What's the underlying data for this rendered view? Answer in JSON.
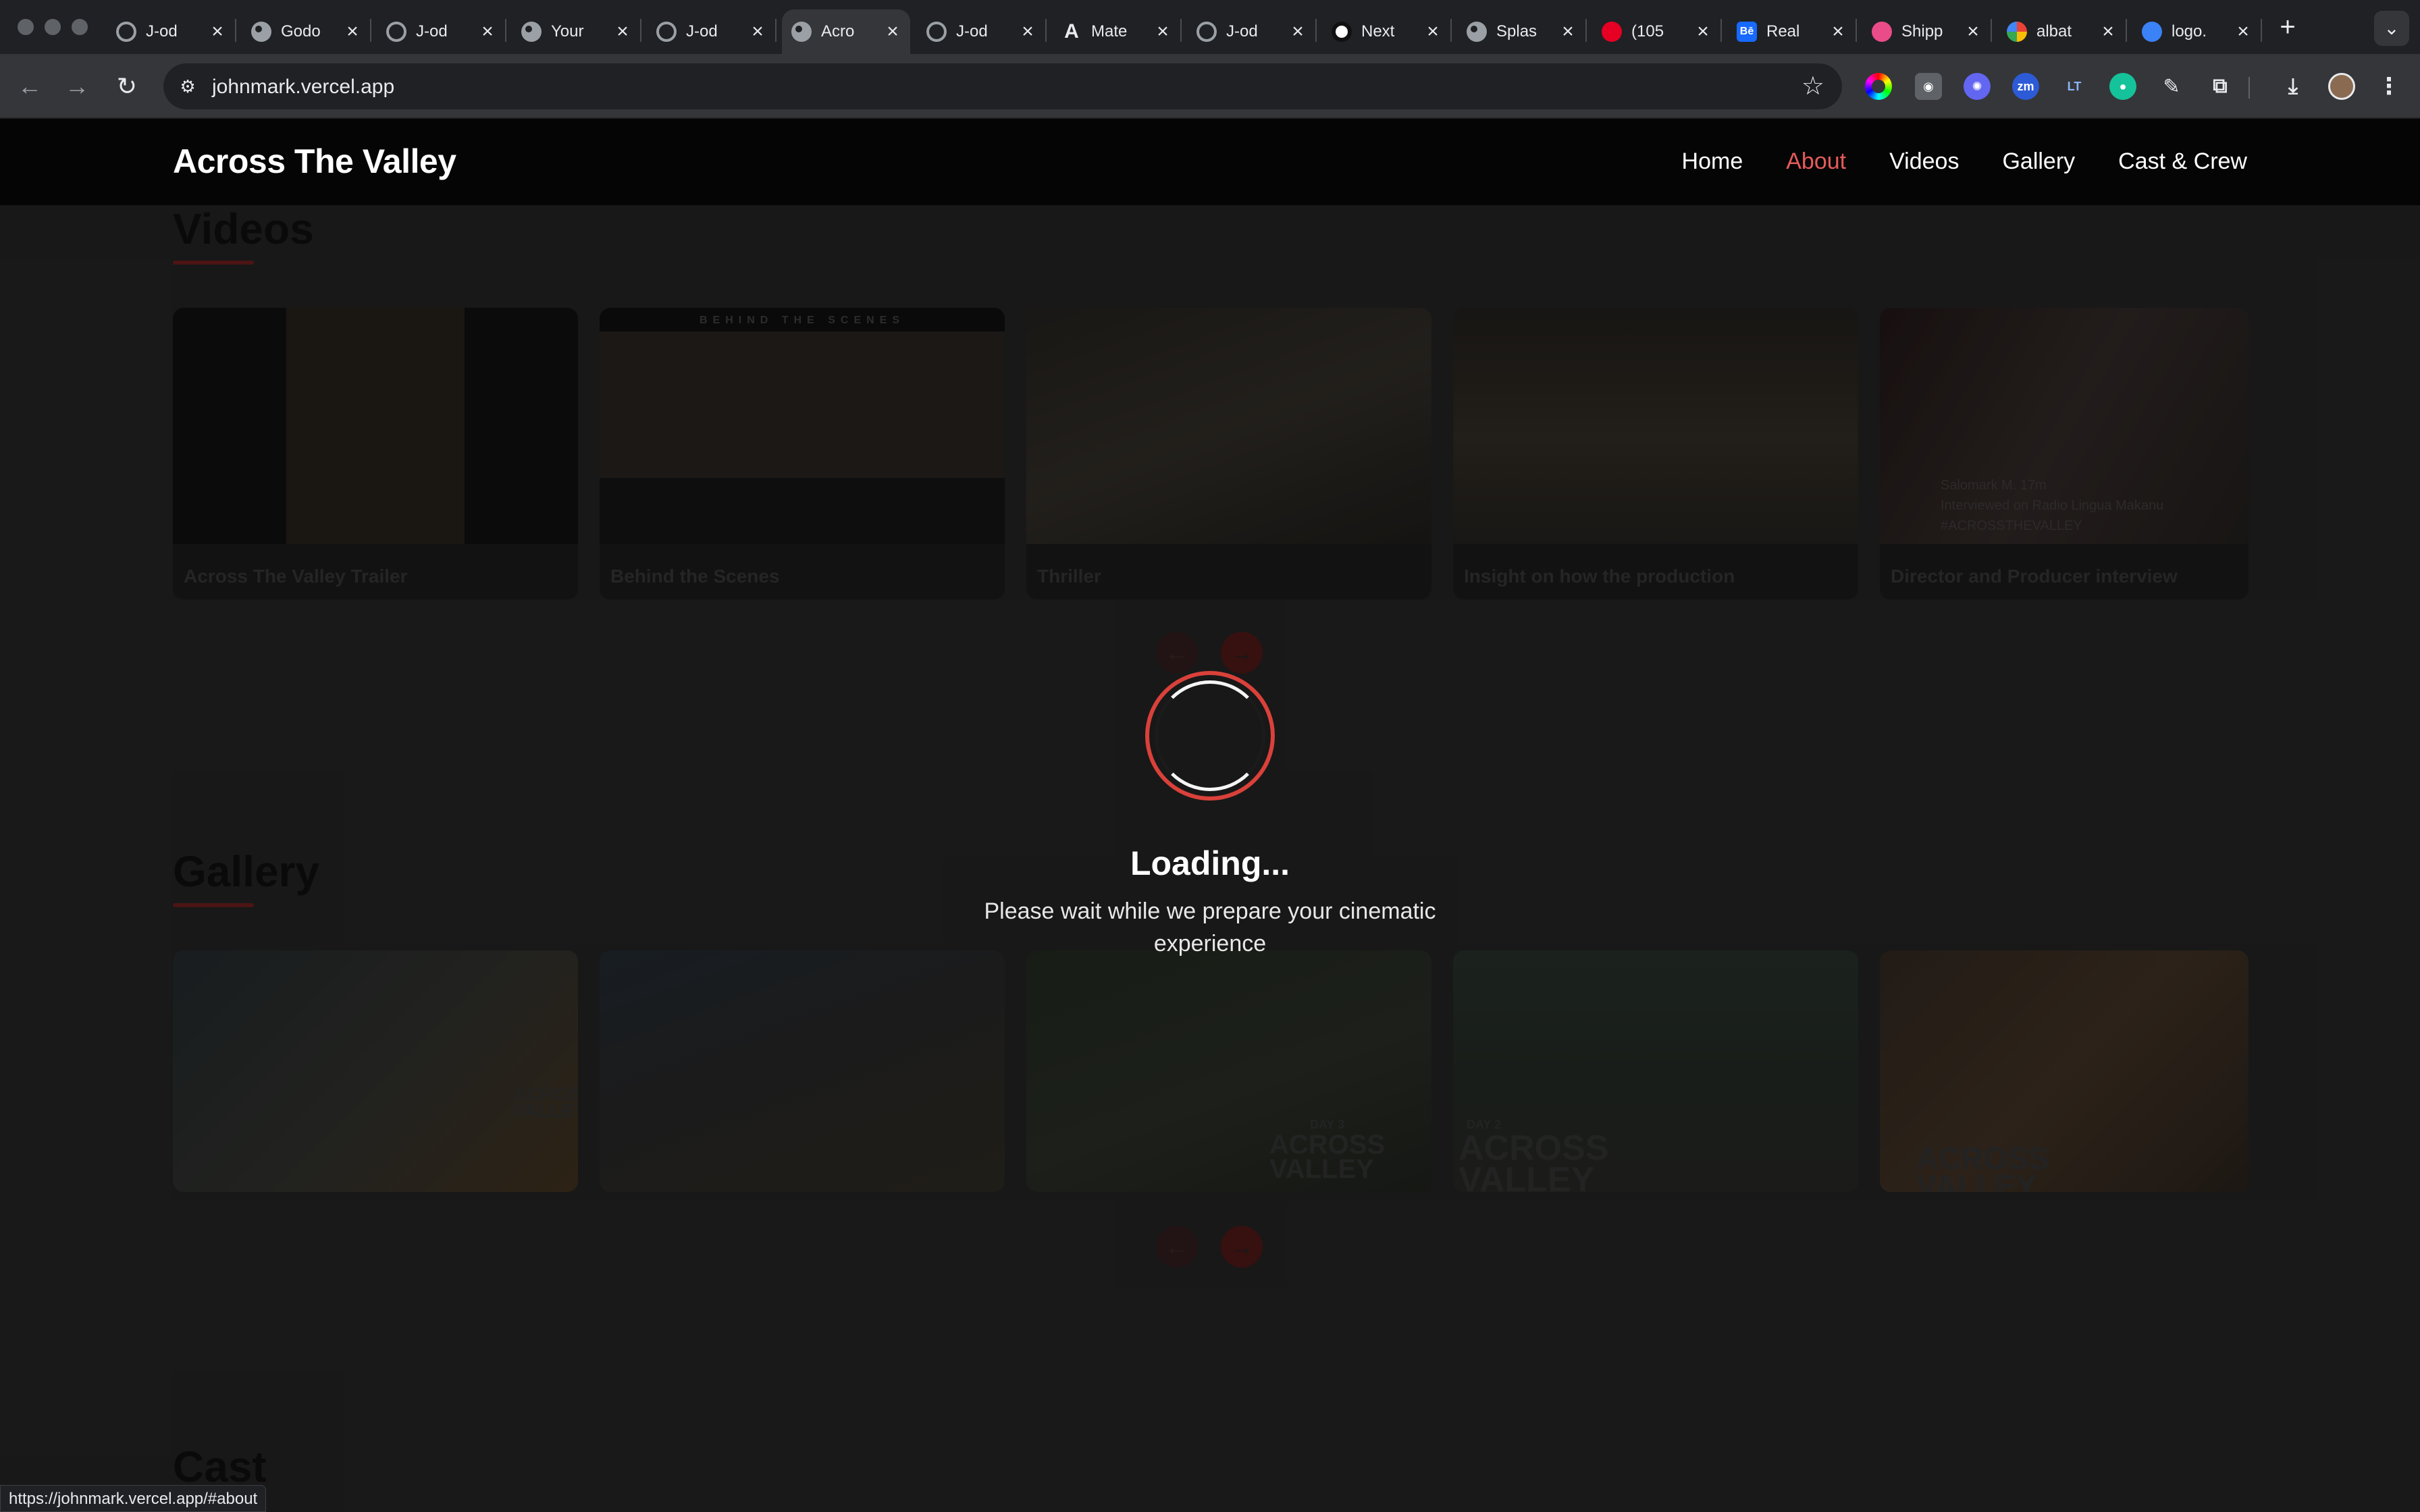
{
  "browser": {
    "tabs": [
      {
        "title": "J-od",
        "icon": "github-icon",
        "fav": "gh"
      },
      {
        "title": "Godo",
        "icon": "globe-icon",
        "fav": "globe"
      },
      {
        "title": "J-od",
        "icon": "github-icon",
        "fav": "gh"
      },
      {
        "title": "Your",
        "icon": "globe-icon",
        "fav": "globe"
      },
      {
        "title": "J-od",
        "icon": "github-icon",
        "fav": "gh"
      },
      {
        "title": "Acro",
        "icon": "globe-icon",
        "fav": "globe",
        "active": true
      },
      {
        "title": "J-od",
        "icon": "github-icon",
        "fav": "gh"
      },
      {
        "title": "Mate",
        "icon": "anthropic-icon",
        "fav": "anth"
      },
      {
        "title": "J-od",
        "icon": "github-icon",
        "fav": "gh"
      },
      {
        "title": "Next",
        "icon": "openai-icon",
        "fav": "openai"
      },
      {
        "title": "Splas",
        "icon": "globe-icon",
        "fav": "globe"
      },
      {
        "title": "(105",
        "icon": "pinterest-icon",
        "fav": "pin"
      },
      {
        "title": "Real",
        "icon": "behance-icon",
        "fav": "be"
      },
      {
        "title": "Shipp",
        "icon": "dribbble-icon",
        "fav": "dribbble"
      },
      {
        "title": "albat",
        "icon": "google-icon",
        "fav": "google"
      },
      {
        "title": "logo.",
        "icon": "logo-icon",
        "fav": "logo"
      }
    ],
    "url": "johnmark.vercel.app",
    "status_url": "https://johnmark.vercel.app/#about"
  },
  "site": {
    "brand": "Across The Valley",
    "nav": [
      "Home",
      "About",
      "Videos",
      "Gallery",
      "Cast & Crew"
    ],
    "active_nav": "About"
  },
  "videos": {
    "title": "Videos",
    "items": [
      "Across The Valley Trailer",
      "Behind the Scenes",
      "Thriller",
      "Insight on how the production",
      "Director and Producer interview"
    ],
    "bts_banner": "BEHIND THE SCENES",
    "interview_overlay": [
      "Salomark M. 17m",
      "Interviewed on Radio Lingua Makanu",
      "#ACROSSTHEVALLEY"
    ]
  },
  "gallery": {
    "title": "Gallery",
    "watermarks": [
      "ACROSS VALLEY",
      "",
      "ACROSS VALLEY",
      "ACROSS VALLEY",
      "ACROSS VALLEY"
    ],
    "watermark_kicker": [
      "",
      "",
      "DAY 3",
      "DAY 2",
      ""
    ]
  },
  "cast": {
    "title": "Cast"
  },
  "loader": {
    "title": "Loading...",
    "subtitle": "Please wait while we prepare your cinematic experience"
  },
  "colors": {
    "accent": "#e65b5b",
    "spinner_ring": "#d9413a",
    "nav_bg": "#050505",
    "page_bg": "#1b1b1b"
  }
}
